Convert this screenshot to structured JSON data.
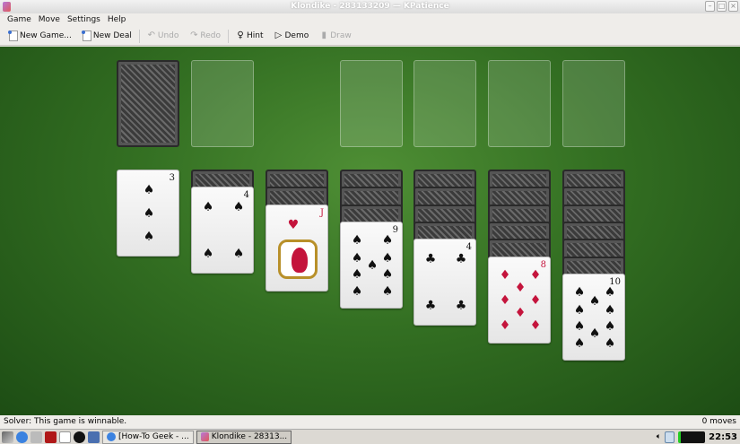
{
  "window": {
    "title": "Klondike - 283133209 — KPatience",
    "buttons": [
      "minimize",
      "maximize",
      "close"
    ]
  },
  "menu": [
    "Game",
    "Move",
    "Settings",
    "Help"
  ],
  "toolbar": [
    {
      "label": "New Game...",
      "icon": "new-document-icon",
      "enabled": true
    },
    {
      "label": "New Deal",
      "icon": "new-document-icon",
      "enabled": true
    },
    {
      "label": "Undo",
      "icon": "undo-arrow-icon",
      "enabled": false
    },
    {
      "label": "Redo",
      "icon": "redo-arrow-icon",
      "enabled": false
    },
    {
      "label": "Hint",
      "icon": "lightbulb-icon",
      "enabled": true
    },
    {
      "label": "Demo",
      "icon": "play-icon",
      "enabled": true
    },
    {
      "label": "Draw",
      "icon": "draw-cards-icon",
      "enabled": false
    }
  ],
  "game": {
    "stock": {
      "face_down": true
    },
    "waste": {
      "empty": true
    },
    "foundations": 4,
    "tableau": [
      {
        "face_down": 0,
        "card": {
          "rank": "3",
          "suit": "spades"
        }
      },
      {
        "face_down": 1,
        "card": {
          "rank": "4",
          "suit": "spades"
        }
      },
      {
        "face_down": 2,
        "card": {
          "rank": "J",
          "suit": "hearts"
        }
      },
      {
        "face_down": 3,
        "card": {
          "rank": "9",
          "suit": "spades"
        }
      },
      {
        "face_down": 4,
        "card": {
          "rank": "4",
          "suit": "clubs"
        }
      },
      {
        "face_down": 5,
        "card": {
          "rank": "8",
          "suit": "diamonds"
        }
      },
      {
        "face_down": 6,
        "card": {
          "rank": "10",
          "suit": "spades"
        }
      }
    ],
    "felt_color": "#336f22"
  },
  "status": {
    "left": "Solver: This game is winnable.",
    "right": "0 moves"
  },
  "taskbar": {
    "tasks": [
      {
        "label": "[How-To Geek - ...",
        "icon": "chrome-icon"
      },
      {
        "label": "Klondike - 28313...",
        "icon": "kpatience-icon",
        "active": true
      }
    ],
    "clock": "22:53"
  }
}
